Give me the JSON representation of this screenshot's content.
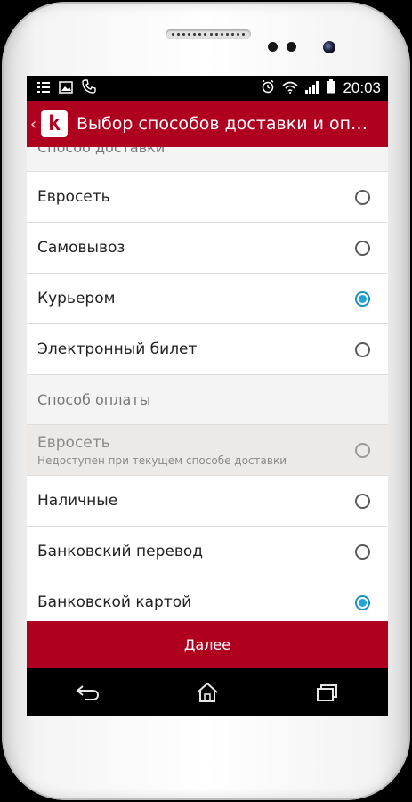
{
  "status_bar": {
    "time": "20:03",
    "icons": [
      "notification-list-icon",
      "image-icon",
      "phone-call-icon",
      "alarm-icon",
      "wifi-icon",
      "signal-icon",
      "battery-icon"
    ]
  },
  "action_bar": {
    "title": "Выбор способов доставки и оплаты",
    "back_icon": "chevron-left-icon",
    "logo_letter": "k",
    "color": "#b00020"
  },
  "delivery": {
    "header": "Способ доставки",
    "options": [
      {
        "label": "Евросеть",
        "checked": false
      },
      {
        "label": "Самовывоз",
        "checked": false
      },
      {
        "label": "Курьером",
        "checked": true
      },
      {
        "label": "Электронный билет",
        "checked": false
      }
    ]
  },
  "payment": {
    "header": "Способ оплаты",
    "options": [
      {
        "label": "Евросеть",
        "sublabel": "Недоступен при текущем способе доставки",
        "checked": false,
        "disabled": true
      },
      {
        "label": "Наличные",
        "checked": false
      },
      {
        "label": "Банковский перевод",
        "checked": false
      },
      {
        "label": "Банковской картой",
        "checked": true
      }
    ]
  },
  "next_button": {
    "label": "Далее"
  },
  "nav_bar": {
    "icons": [
      "back-arrow-icon",
      "home-icon",
      "recent-apps-icon"
    ]
  },
  "colors": {
    "accent": "#b00020",
    "radio_checked": "#23a4d8"
  }
}
